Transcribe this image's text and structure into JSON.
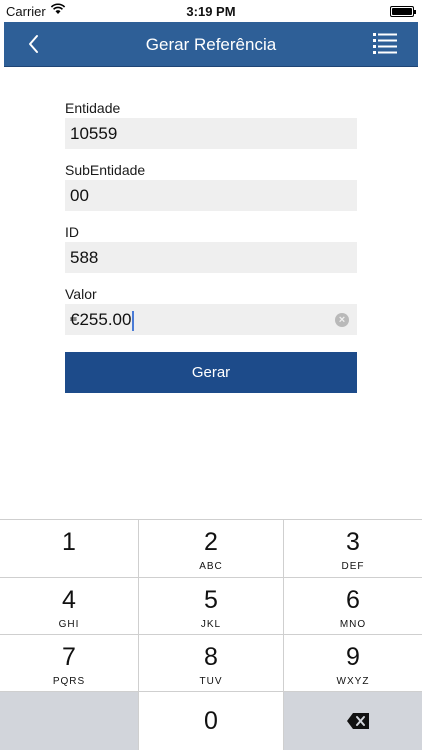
{
  "status_bar": {
    "carrier": "Carrier",
    "time": "3:19 PM"
  },
  "nav": {
    "title": "Gerar Referência",
    "back_icon": "chevron-left-icon",
    "menu_icon": "list-menu-icon"
  },
  "form": {
    "fields": [
      {
        "label": "Entidade",
        "value": "10559"
      },
      {
        "label": "SubEntidade",
        "value": "00"
      },
      {
        "label": "ID",
        "value": "588"
      },
      {
        "label": "Valor",
        "value": "€255.00"
      }
    ],
    "submit_label": "Gerar"
  },
  "keypad": {
    "keys": [
      {
        "num": "1",
        "letters": ""
      },
      {
        "num": "2",
        "letters": "ABC"
      },
      {
        "num": "3",
        "letters": "DEF"
      },
      {
        "num": "4",
        "letters": "GHI"
      },
      {
        "num": "5",
        "letters": "JKL"
      },
      {
        "num": "6",
        "letters": "MNO"
      },
      {
        "num": "7",
        "letters": "PQRS"
      },
      {
        "num": "8",
        "letters": "TUV"
      },
      {
        "num": "9",
        "letters": "WXYZ"
      },
      {
        "num": "0",
        "letters": ""
      }
    ],
    "delete_icon": "backspace-icon"
  },
  "colors": {
    "nav_bar": "#2e5f97",
    "button": "#1d4b8a",
    "input_bg": "#efefef",
    "keypad_gray": "#d2d5db"
  }
}
